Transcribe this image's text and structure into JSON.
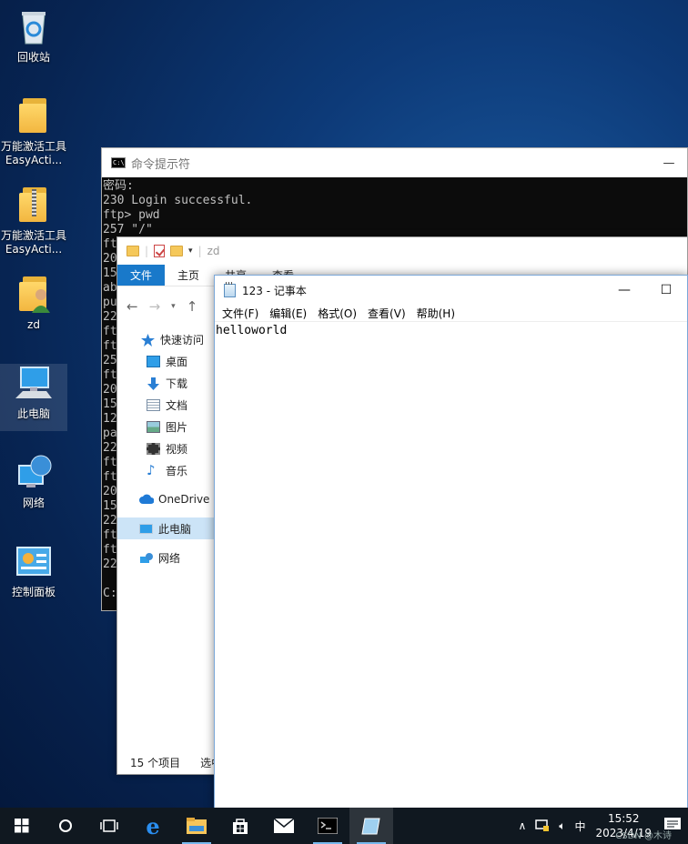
{
  "desktop": {
    "icons": [
      {
        "label": "回收站",
        "icon": "recycle-bin-icon"
      },
      {
        "label": "万能激活工具EasyActi...",
        "icon": "folder-icon"
      },
      {
        "label": "万能激活工具EasyActi...",
        "icon": "zip-folder-icon"
      },
      {
        "label": "zd",
        "icon": "user-folder-icon"
      },
      {
        "label": "此电脑",
        "icon": "computer-icon"
      },
      {
        "label": "网络",
        "icon": "network-icon"
      },
      {
        "label": "控制面板",
        "icon": "control-panel-icon"
      }
    ]
  },
  "cmd": {
    "title": "命令提示符",
    "minimize": "—",
    "lines": [
      "密码:",
      "230 Login successful.",
      "ftp> pwd",
      "257 \"/\"",
      "ft",
      "20",
      "15",
      "ab",
      "pu",
      "22",
      "ft",
      "ft",
      "25",
      "ft",
      "20",
      "15",
      "12",
      "pa",
      "22",
      "ft",
      "ft",
      "20",
      "15",
      "22",
      "ft",
      "ft",
      "22",
      "",
      "C:"
    ]
  },
  "explorer": {
    "path_label": "zd",
    "ribbon_tabs": [
      "文件",
      "主页",
      "共享",
      "查看"
    ],
    "nav_items": [
      {
        "label": "快速访问",
        "icon": "star-icon"
      },
      {
        "label": "桌面",
        "icon": "desktop-icon"
      },
      {
        "label": "下载",
        "icon": "download-icon"
      },
      {
        "label": "文档",
        "icon": "document-icon"
      },
      {
        "label": "图片",
        "icon": "picture-icon"
      },
      {
        "label": "视频",
        "icon": "video-icon"
      },
      {
        "label": "音乐",
        "icon": "music-icon"
      },
      {
        "label": "OneDrive",
        "icon": "onedrive-icon"
      },
      {
        "label": "此电脑",
        "icon": "computer-icon"
      },
      {
        "label": "网络",
        "icon": "network-icon"
      }
    ],
    "status": {
      "count": "15 个项目",
      "selected": "选中"
    }
  },
  "notepad": {
    "title": "123 - 记事本",
    "menus": [
      "文件(F)",
      "编辑(E)",
      "格式(O)",
      "查看(V)",
      "帮助(H)"
    ],
    "content": "helloworld"
  },
  "taskbar": {
    "apps": [
      "start-icon",
      "search-icon",
      "task-view-icon",
      "edge-icon",
      "file-explorer-icon",
      "store-icon",
      "mail-icon",
      "cmd-icon",
      "notepad-icon"
    ],
    "tray": {
      "ime": "中",
      "time": "15:52",
      "date": "2023/4/19"
    },
    "watermark": "CSDN @木诗"
  },
  "colors": {
    "accent": "#1979ca",
    "taskbar": "#101820"
  }
}
